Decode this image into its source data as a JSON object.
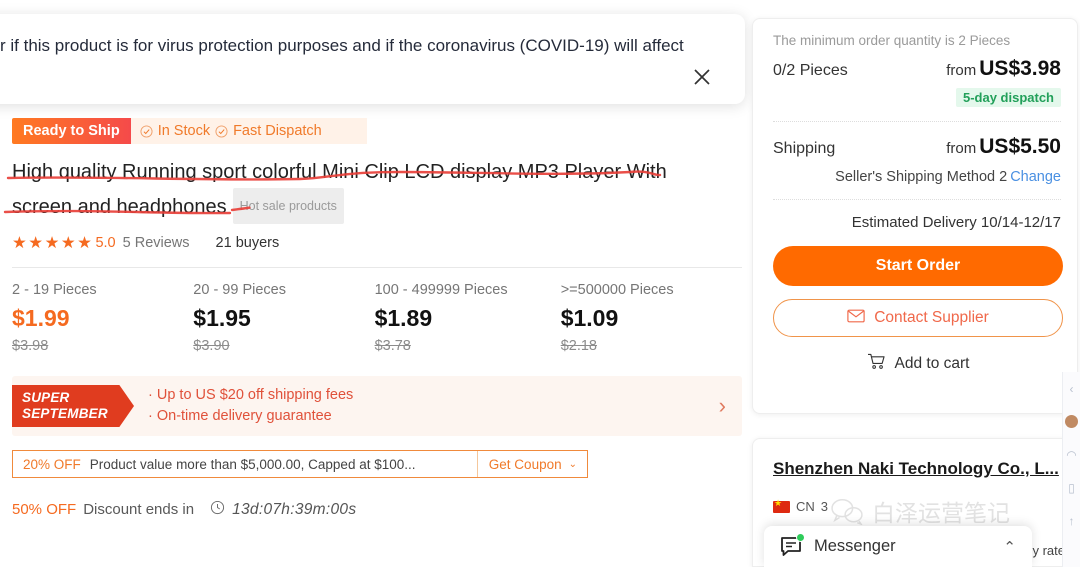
{
  "notice": {
    "text": "r if this product is for virus protection purposes and if the coronavirus (COVID-19) will affect",
    "close_icon": "close-icon"
  },
  "product": {
    "ready_badge": "Ready to Ship",
    "stock_label": "In Stock",
    "dispatch_label": "Fast Dispatch",
    "title": "High quality Running sport colorful Mini Clip LCD display MP3 Player With screen and headphones",
    "hot_tag": "Hot sale products",
    "stars": "★★★★★",
    "score": "5.0",
    "reviews": "5 Reviews",
    "buyers": "21 buyers"
  },
  "tiers": [
    {
      "range": "2 - 19 Pieces",
      "price": "$1.99",
      "old": "$3.98"
    },
    {
      "range": "20 - 99 Pieces",
      "price": "$1.95",
      "old": "$3.90"
    },
    {
      "range": "100 - 499999 Pieces",
      "price": "$1.89",
      "old": "$3.78"
    },
    {
      "range": ">=500000 Pieces",
      "price": "$1.09",
      "old": "$2.18"
    }
  ],
  "promo": {
    "tag_line1": "SUPER",
    "tag_line2": "SEPTEMBER",
    "line1": "· Up to US $20 off shipping fees",
    "line2": "· On-time delivery guarantee",
    "arrow": "›"
  },
  "coupon": {
    "off": "20% OFF",
    "desc": "Product value more than $5,000.00, Capped at $100...",
    "get": "Get Coupon",
    "caret": "⌄"
  },
  "countdown": {
    "off": "50% OFF",
    "label": "Discount ends in",
    "time": "13d:07h:39m:00s"
  },
  "order": {
    "min_note": "The minimum order quantity is 2 Pieces",
    "qty": "0/2 Pieces",
    "price_from": "from",
    "price": "US$3.98",
    "dispatch_badge": "5-day dispatch",
    "shipping_label": "Shipping",
    "shipping_from": "from",
    "shipping_price": "US$5.50",
    "method": "Seller's Shipping Method 2",
    "change": "Change",
    "eta": "Estimated Delivery 10/14-12/17",
    "start_order": "Start Order",
    "contact_supplier": "Contact Supplier",
    "add_to_cart": "Add to cart"
  },
  "supplier": {
    "name": "Shenzhen Naki Technology Co., L...",
    "country_code": "CN",
    "years": "3",
    "response_label": "y rate"
  },
  "watermark": {
    "text": "白泽运营笔记"
  },
  "messenger": {
    "label": "Messenger",
    "caret": "⌃"
  },
  "colors": {
    "accent_orange": "#ff6a00",
    "price_orange": "#f56a20",
    "promo_red": "#e03c1f",
    "green": "#22a05a",
    "link_blue": "#4a90e2",
    "annotation_red": "#e8403a"
  }
}
